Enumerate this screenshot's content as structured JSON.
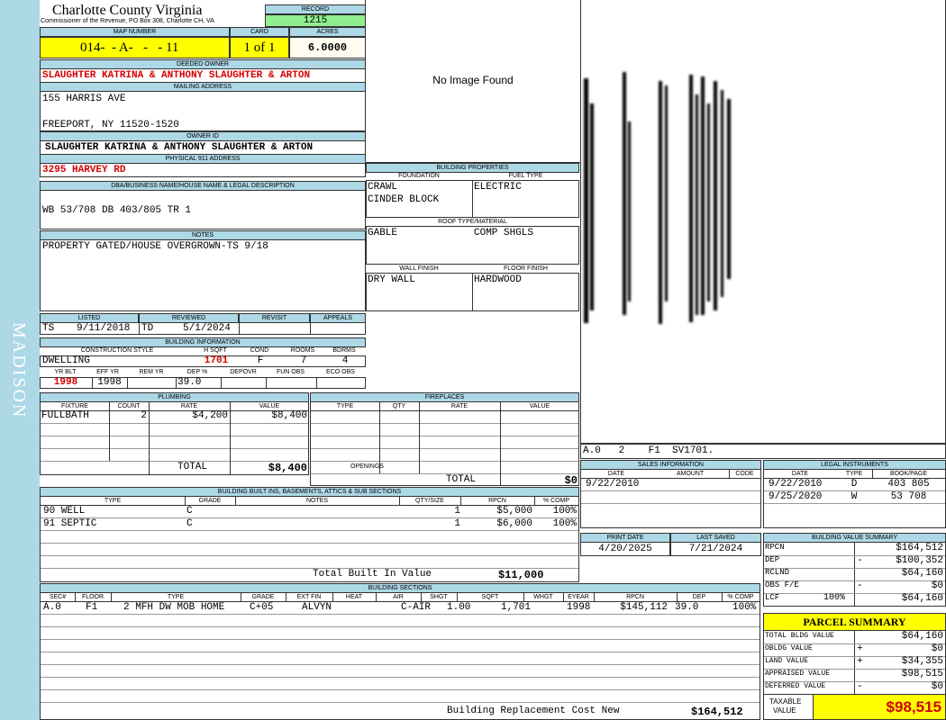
{
  "side_label": "MADISON",
  "header": {
    "county": "Charlotte County Virginia",
    "subtitle": "Commissioner of the Revenue, PO Box 308, Charlotte CH, VA",
    "record_label": "RECORD",
    "record": "1215",
    "map_label": "MAP NUMBER",
    "map_number": "014-  - A-   -   - 11",
    "card_label": "CARD",
    "card": "1 of 1",
    "acres_label": "ACRES",
    "acres": "6.0000"
  },
  "owner": {
    "deeded_label": "DEEDED OWNER",
    "deeded": "SLAUGHTER KATRINA & ANTHONY SLAUGHTER & ARTON",
    "mailing_label": "MAILING ADDRESS",
    "address1": "155 HARRIS AVE",
    "address2": "FREEPORT, NY 11520-1520",
    "ownerid_label": "OWNER ID",
    "ownerid": "SLAUGHTER KATRINA & ANTHONY SLAUGHTER & ARTON",
    "physical_label": "PHYSICAL 911 ADDRESS",
    "physical": "3295 HARVEY RD"
  },
  "dba": {
    "label": "DBA/BUSINESS NAME/HOUSE NAME & LEGAL DESCRIPTION",
    "value": "WB 53/708 DB 403/805 TR 1"
  },
  "notes": {
    "label": "NOTES",
    "value": "PROPERTY GATED/HOUSE OVERGROWN-TS 9/18"
  },
  "review": {
    "listed_label": "LISTED",
    "reviewed_label": "REVIEWED",
    "revisit_label": "REVISIT",
    "appeals_label": "APPEALS",
    "listed_by": "TS",
    "listed_date": "9/11/2018",
    "reviewed_by": "TD",
    "reviewed_date": "5/1/2024"
  },
  "building_info": {
    "label": "BUILDING INFORMATION",
    "h_style": "CONSTRUCTION STYLE",
    "h_sqft": "H SQFT",
    "h_cond": "COND",
    "h_rooms": "ROOMS",
    "h_bdrms": "BDRMS",
    "style": "DWELLING",
    "sqft": "1701",
    "cond": "F",
    "rooms": "7",
    "bdrms": "4",
    "h_yrblt": "YR BLT",
    "h_effyr": "EFF YR",
    "h_remyr": "REM YR",
    "h_dep": "DEP %",
    "h_depovr": "DEPOVR",
    "h_funobs": "FUN OBS",
    "h_ecoobs": "ECO OBS",
    "yrblt": "1998",
    "effyr": "1998",
    "dep": "39.0"
  },
  "image_panel": {
    "no_image": "No Image Found"
  },
  "sketch": {
    "caption": "A.0   2    F1  SV1701."
  },
  "building_properties": {
    "label": "BUILDING PROPERTIES",
    "foundation_label": "FOUNDATION",
    "fuel_label": "FUEL TYPE",
    "foundation1": "CRAWL",
    "foundation2": "CINDER BLOCK",
    "fuel": "ELECTRIC",
    "roof_label": "ROOF TYPE/MATERIAL",
    "roof_type": "GABLE",
    "roof_material": "COMP SHGLS",
    "wall_label": "WALL FINISH",
    "floor_label": "FLOOR FINISH",
    "wall": "DRY WALL",
    "floor": "HARDWOOD"
  },
  "plumbing": {
    "label": "PLUMBING",
    "h_fixture": "FIXTURE",
    "h_count": "COUNT",
    "h_rate": "RATE",
    "h_value": "VALUE",
    "fixture": "FULLBATH",
    "count": "2",
    "rate": "$4,200",
    "value": "$8,400",
    "total_label": "TOTAL",
    "total": "$8,400"
  },
  "fireplaces": {
    "label": "FIREPLACES",
    "h_type": "TYPE",
    "h_qty": "QTY",
    "h_rate": "RATE",
    "h_value": "VALUE",
    "openings_label": "OPENINGS",
    "total_label": "TOTAL",
    "total": "$0"
  },
  "sales": {
    "label": "SALES INFORMATION",
    "h_date": "DATE",
    "h_amount": "AMOUNT",
    "h_code": "CODE",
    "date": "9/22/2010"
  },
  "legal": {
    "label": "LEGAL INSTRUMENTS",
    "h_date": "DATE",
    "h_type": "TYPE",
    "h_book": "BOOK/PAGE",
    "rows": [
      {
        "date": "9/22/2010",
        "type": "D",
        "book": "403 805"
      },
      {
        "date": "9/25/2020",
        "type": "W",
        "book": "53 708"
      }
    ]
  },
  "builtins": {
    "label": "BUILDING BUILT INS, BASEMENTS, ATTICS & SUB SECTIONS",
    "h_type": "TYPE",
    "h_grade": "GRADE",
    "h_notes": "NOTES",
    "h_qty": "QTY/SIZE",
    "h_rpcn": "RPCN",
    "h_comp": "% COMP",
    "rows": [
      {
        "type": "90 WELL",
        "grade": "C",
        "qty": "1",
        "rpcn": "$5,000",
        "comp": "100%"
      },
      {
        "type": "91 SEPTIC",
        "grade": "C",
        "qty": "1",
        "rpcn": "$6,000",
        "comp": "100%"
      }
    ],
    "total_label": "Total Built In Value",
    "total": "$11,000"
  },
  "print": {
    "print_label": "PRINT DATE",
    "saved_label": "LAST SAVED",
    "print_date": "4/20/2025",
    "last_saved": "7/21/2024"
  },
  "value_summary": {
    "label": "BUILDING VALUE SUMMARY",
    "rpcn_label": "RPCN",
    "rpcn": "$164,512",
    "dep_label": "DEP",
    "dep_sign": "-",
    "dep": "$100,352",
    "rclnd_label": "RCLND",
    "rclnd": "$64,160",
    "obs_label": "OBS F/E",
    "obs_sign": "-",
    "obs": "$0",
    "lcf_label": "LCF",
    "lcf_pct": "100%",
    "lcf": "$64,160"
  },
  "sections": {
    "label": "BUILDING SECTIONS",
    "h_sec": "SEC#",
    "h_floor": "FLOOR",
    "h_type": "TYPE",
    "h_grade": "GRADE",
    "h_extfin": "EXT FIN",
    "h_heat": "HEAT",
    "h_air": "AIR",
    "h_shgt": "SHGT",
    "h_sqft": "SQFT",
    "h_whgt": "WHGT",
    "h_eyear": "EYEAR",
    "h_rpcn": "RPCN",
    "h_dep": "DEP",
    "h_comp": "% COMP",
    "row": {
      "sec": "A.0",
      "floor": "F1",
      "type": "2 MFH DW MOB HOME",
      "grade": "C+05",
      "extfin": "ALVYN",
      "air": "C-AIR",
      "shgt": "1.00",
      "sqft": "1,701",
      "eyear": "1998",
      "rpcn": "$145,112",
      "dep": "39.0",
      "comp": "100%"
    },
    "replacement_label": "Building Replacement Cost New",
    "replacement": "$164,512"
  },
  "parcel": {
    "label": "PARCEL SUMMARY",
    "bldg_label": "TOTAL BLDG VALUE",
    "bldg": "$64,160",
    "obldg_label": "OBLDG VALUE",
    "obldg_sign": "+",
    "obldg": "$0",
    "land_label": "LAND VALUE",
    "land_sign": "+",
    "land": "$34,355",
    "appraised_label": "APPRAISED VALUE",
    "appraised": "$98,515",
    "deferred_label": "DEFERRED VALUE",
    "deferred_sign": "-",
    "deferred": "$0",
    "taxable_label1": "TAXABLE",
    "taxable_label2": "VALUE",
    "taxable": "$98,515"
  },
  "colors": {
    "header_bg": "#add8e6",
    "highlight": "#ffff00",
    "record_bg": "#90ee90",
    "accent_red": "#d40000"
  }
}
